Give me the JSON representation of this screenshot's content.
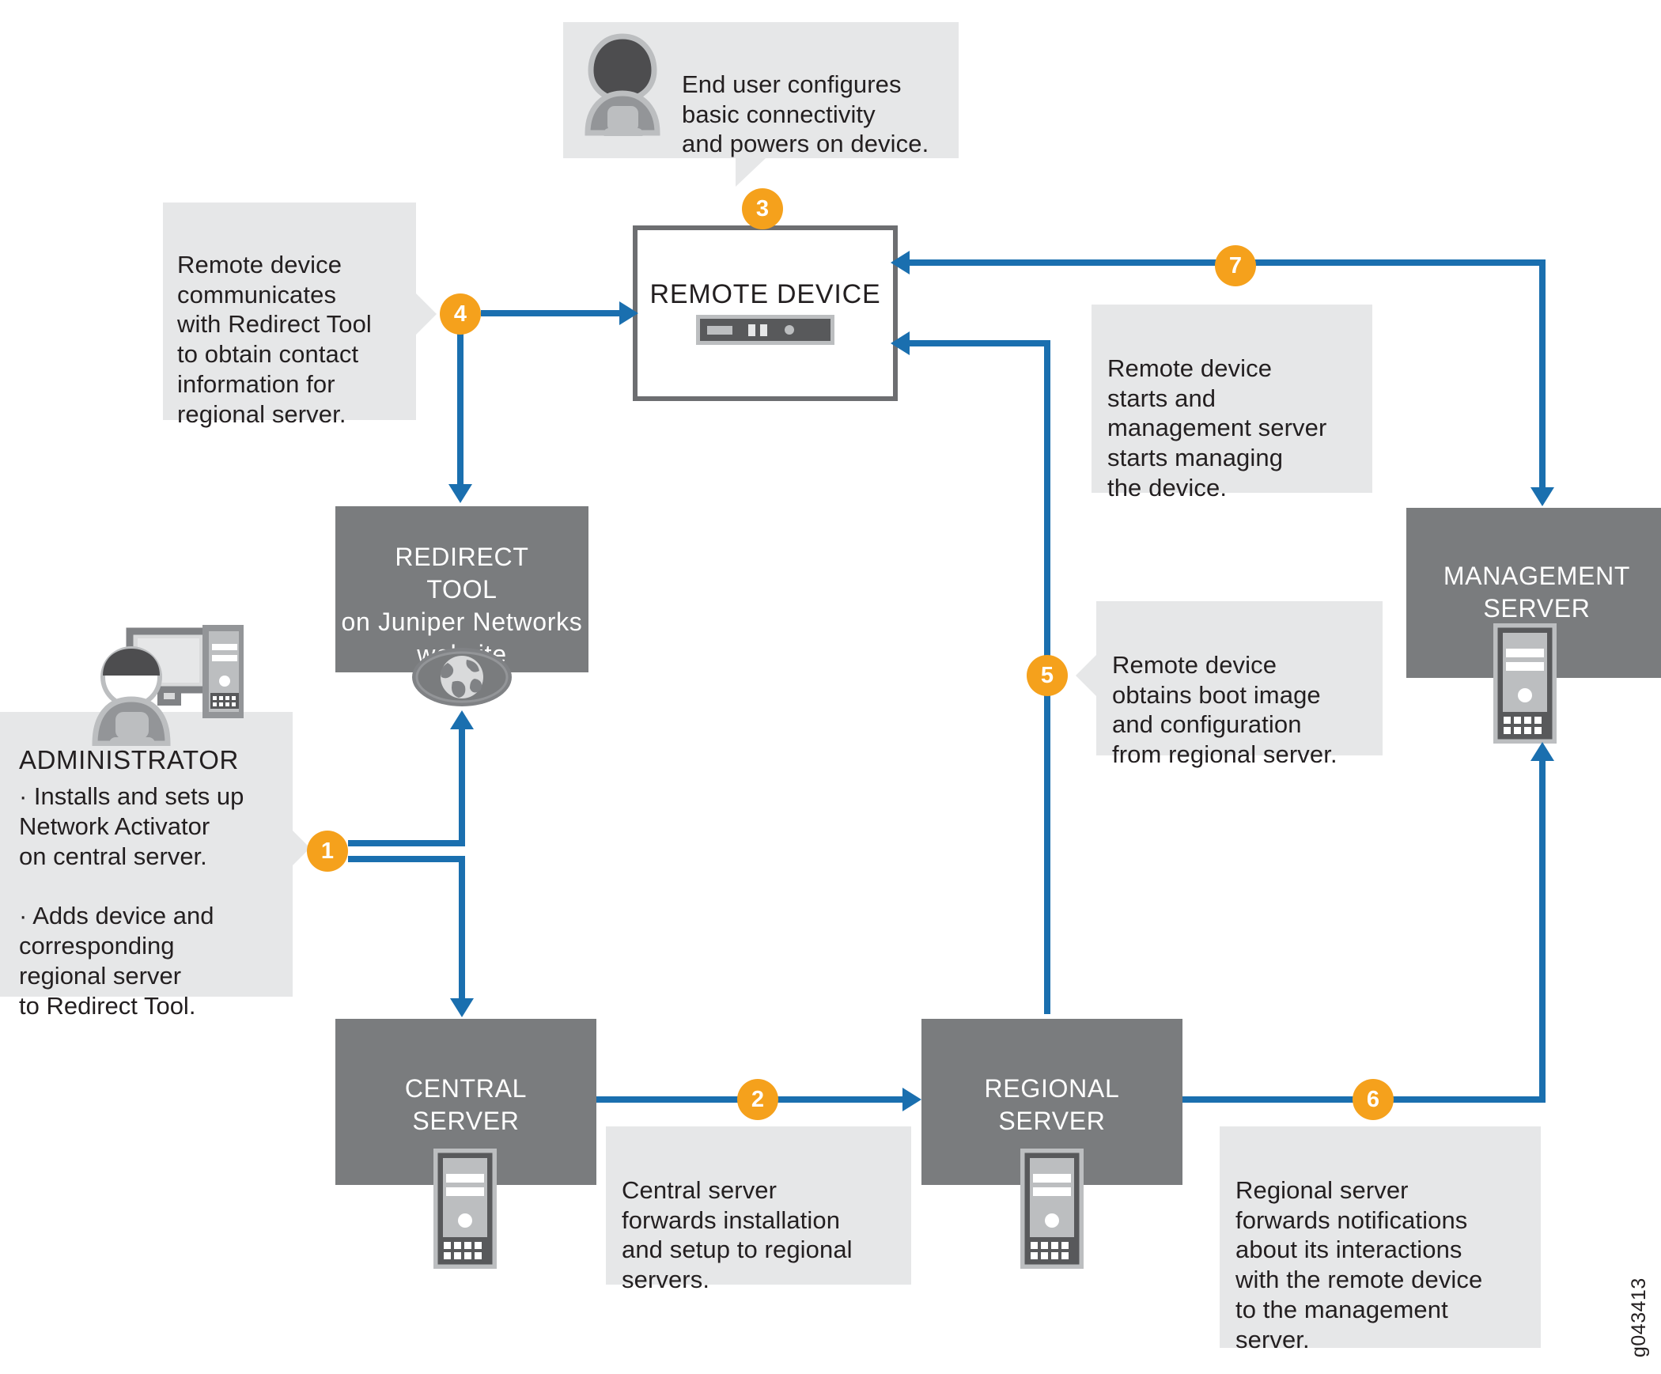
{
  "diagram": {
    "figure_id": "g043413",
    "colors": {
      "accent_badge": "#f5a11c",
      "connector": "#1a6faf",
      "node_fill": "#7a7c7e",
      "callout_fill": "#e6e7e8",
      "text": "#231f20"
    }
  },
  "nodes": {
    "remote_device": {
      "label": "REMOTE DEVICE",
      "icon": "network-device-icon"
    },
    "redirect_tool": {
      "label": "REDIRECT\nTOOL\non Juniper Networks\nwebsite",
      "icon": "globe-icon"
    },
    "central_server": {
      "label": "CENTRAL\nSERVER",
      "icon": "server-tower-icon"
    },
    "regional_server": {
      "label": "REGIONAL\nSERVER",
      "icon": "server-tower-icon"
    },
    "management_server": {
      "label": "MANAGEMENT\nSERVER",
      "icon": "server-tower-icon"
    }
  },
  "administrator": {
    "title": "ADMINISTRATOR",
    "bullets": "· Installs and sets up\n Network Activator\n on central server.\n\n· Adds device and\n corresponding\n regional server\n to Redirect Tool.",
    "icon": "administrator-workstation-icon"
  },
  "callouts": [
    {
      "step": "3",
      "name": "end-user",
      "text": "End user configures\nbasic connectivity\nand powers on device.",
      "icon": "end-user-icon"
    },
    {
      "step": "4",
      "name": "redirect-contact",
      "text": "Remote device\ncommunicates\nwith Redirect Tool\nto obtain contact\ninformation for\nregional server."
    },
    {
      "step": "7",
      "name": "management-starts",
      "text": "Remote device\nstarts and\nmanagement server\nstarts managing\nthe device."
    },
    {
      "step": "5",
      "name": "boot-image",
      "text": "Remote device\nobtains boot image\nand configuration\nfrom regional server."
    },
    {
      "step": "1",
      "name": "administrator-setup",
      "text": ""
    },
    {
      "step": "2",
      "name": "central-forwards",
      "text": "Central server\nforwards installation\nand setup to regional\nservers."
    },
    {
      "step": "6",
      "name": "regional-notifications",
      "text": "Regional server\nforwards notifications\nabout its interactions\nwith the remote device\nto the management\nserver."
    }
  ],
  "steps": {
    "s1": "1",
    "s2": "2",
    "s3": "3",
    "s4": "4",
    "s5": "5",
    "s6": "6",
    "s7": "7"
  }
}
